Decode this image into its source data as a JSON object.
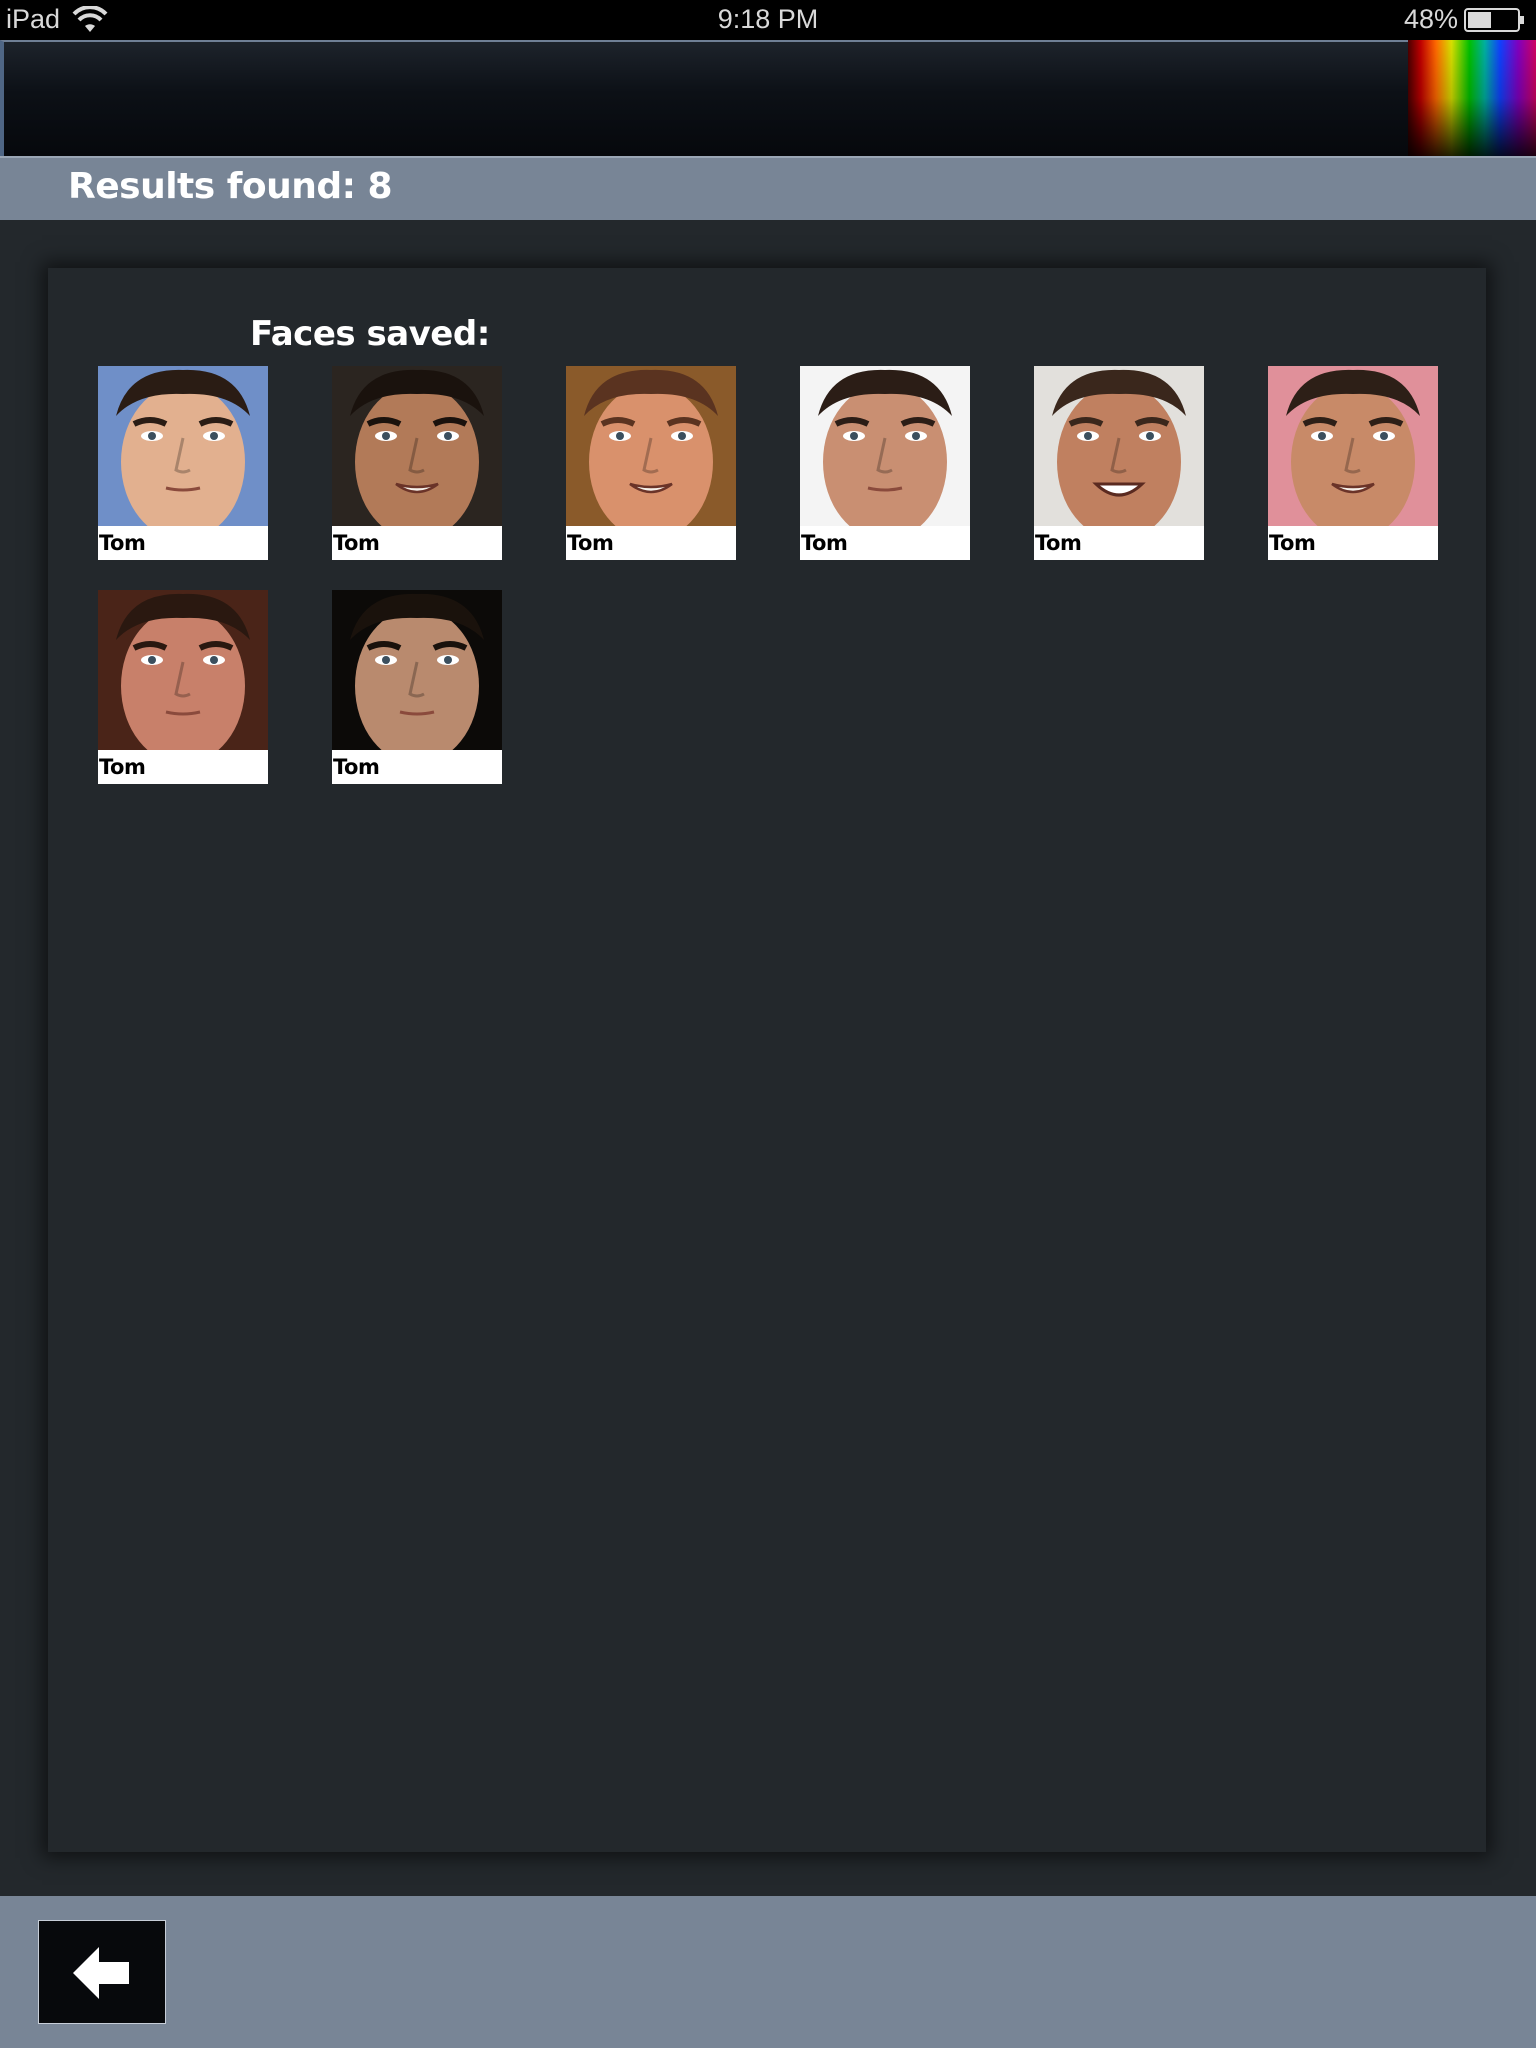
{
  "status_bar": {
    "device": "iPad",
    "time": "9:18 PM",
    "battery": "48%",
    "battery_level": 0.48
  },
  "header": {
    "results_text": "Results found: 8"
  },
  "panel": {
    "title": "Faces saved:"
  },
  "faces": [
    {
      "name": "Tom",
      "bg": "#6f8fc8",
      "skin": "#e2b08f",
      "hair": "#2a1c14",
      "expression": "neutral"
    },
    {
      "name": "Tom",
      "bg": "#2b2520",
      "skin": "#b27a58",
      "hair": "#1a120d",
      "expression": "smile"
    },
    {
      "name": "Tom",
      "bg": "#8a5a2a",
      "skin": "#d9916c",
      "hair": "#5a3320",
      "expression": "smile"
    },
    {
      "name": "Tom",
      "bg": "#f4f4f4",
      "skin": "#c98f72",
      "hair": "#2b1d16",
      "expression": "neutral"
    },
    {
      "name": "Tom",
      "bg": "#e2e0dc",
      "skin": "#c08060",
      "hair": "#3a271c",
      "expression": "grin"
    },
    {
      "name": "Tom",
      "bg": "#e0909a",
      "skin": "#c88a68",
      "hair": "#2d1f17",
      "expression": "smile"
    },
    {
      "name": "Tom",
      "bg": "#4a2418",
      "skin": "#c8806a",
      "hair": "#2a1810",
      "expression": "neutral"
    },
    {
      "name": "Tom",
      "bg": "#0c0a08",
      "skin": "#b98a6e",
      "hair": "#1a120c",
      "expression": "neutral"
    }
  ],
  "icons": {
    "back": "arrow-left-icon",
    "wifi": "wifi-icon",
    "battery": "battery-icon"
  },
  "colors": {
    "accent_bar": "#788596",
    "panel_bg": "#23282c",
    "toolbar_bg": "#06080c"
  }
}
